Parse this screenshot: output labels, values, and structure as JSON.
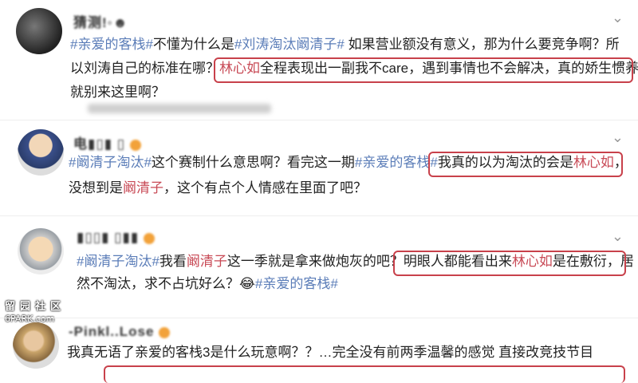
{
  "posts": [
    {
      "username": "猜测!◦☻",
      "line1": {
        "tag1": "#亲爱的客栈#",
        "t1": "不懂为什么是",
        "tag2": "#刘涛淘汰阚清子#",
        "t2": " 如果营业额没有意义，那为什么要竞争啊？所"
      },
      "line2": {
        "t1": "以刘涛自己的标准在哪？",
        "name": "林心如",
        "t2": "全程表现出一副我不care，遇到事情也不会解决，真的娇生惯养"
      },
      "line3": "就别来这里啊？"
    },
    {
      "username": "电▮▯▮ ▯",
      "line1": {
        "tag1": "#阚清子淘汰#",
        "t1": "这个赛制什么意思啊？看完这一期",
        "tag2": "#亲爱的客栈#",
        "t2": "我真的以为淘汰的会是",
        "name": "林心如",
        "t3": "，"
      },
      "line2": {
        "t1": "没想到是",
        "name": "阚清子",
        "t2": "，这个有点个人情感在里面了吧？"
      }
    },
    {
      "username": "▮▯▯▮ ▯▮▮",
      "line1": {
        "tag1": "#阚清子淘汰#",
        "t1": "我看",
        "name1": "阚清子",
        "t2": "这一季就是拿来做炮灰的吧？",
        "t3": "明眼人都能看出来",
        "name2": "林心如",
        "t4": "是在敷衍，居"
      },
      "line2": {
        "t1": "然不淘汰，求不占坑好么？",
        "emoji": "😂",
        "tag": "#亲爱的客栈#"
      }
    },
    {
      "username": "-Pinkl..Lose",
      "line1": "我真无语了亲爱的客栈3是什么玩意啊？？…完全没有前两季温馨的感觉 直接改竞技节目"
    }
  ],
  "watermark": {
    "line1": "留园社区",
    "line2": "6PARK.com"
  },
  "colors": {
    "tag": "#5b7db8",
    "name_red": "#c84a56",
    "box": "#c8414b"
  }
}
